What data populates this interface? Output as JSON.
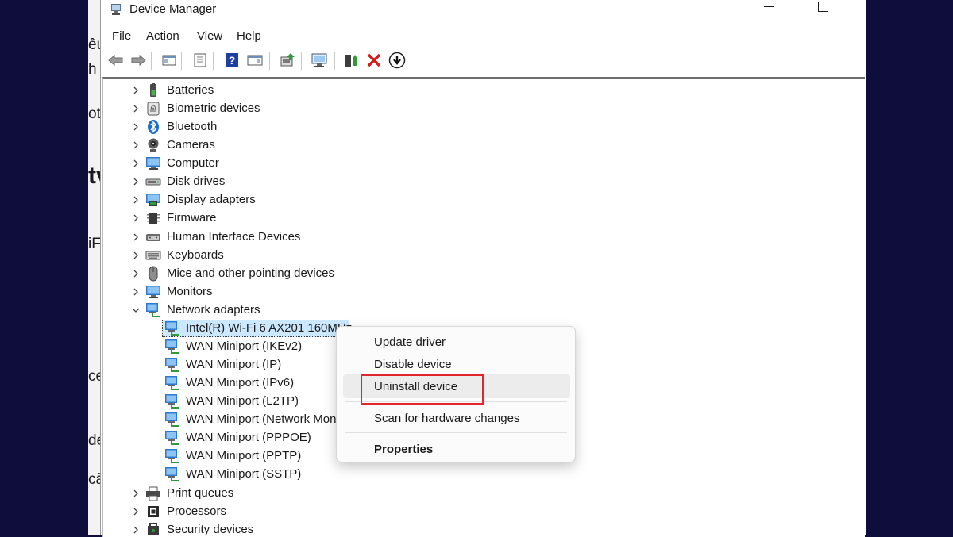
{
  "background_fragments": [
    "êu",
    "h",
    "ot",
    "tv",
    "iF",
    "ce",
    "de",
    "cà"
  ],
  "window": {
    "title": "Device Manager",
    "icons": {
      "app": "device-manager-icon",
      "minimize": "minimize-icon",
      "maximize": "maximize-icon"
    }
  },
  "menu": [
    "File",
    "Action",
    "View",
    "Help"
  ],
  "toolbar": [
    "back-arrow-icon",
    "forward-arrow-icon",
    "show-hide-console-tree-icon",
    "properties-sheet-icon",
    "help-icon",
    "action-pane-icon",
    "update-driver-icon",
    "scan-hardware-icon",
    "enable-device-icon",
    "uninstall-x-icon",
    "download-driver-icon"
  ],
  "tree": {
    "categories": [
      {
        "label": "Batteries",
        "icon": "battery-icon"
      },
      {
        "label": "Biometric devices",
        "icon": "fingerprint-icon"
      },
      {
        "label": "Bluetooth",
        "icon": "bluetooth-icon"
      },
      {
        "label": "Cameras",
        "icon": "camera-icon"
      },
      {
        "label": "Computer",
        "icon": "computer-icon"
      },
      {
        "label": "Disk drives",
        "icon": "disk-drive-icon"
      },
      {
        "label": "Display adapters",
        "icon": "display-adapter-icon"
      },
      {
        "label": "Firmware",
        "icon": "firmware-chip-icon"
      },
      {
        "label": "Human Interface Devices",
        "icon": "hid-icon"
      },
      {
        "label": "Keyboards",
        "icon": "keyboard-icon"
      },
      {
        "label": "Mice and other pointing devices",
        "icon": "mouse-icon"
      },
      {
        "label": "Monitors",
        "icon": "monitor-icon"
      },
      {
        "label": "Network adapters",
        "icon": "network-adapter-icon",
        "expanded": true
      }
    ],
    "network_children": [
      {
        "label": "Intel(R) Wi-Fi 6 AX201 160MHz",
        "selected": true
      },
      {
        "label": "WAN Miniport (IKEv2)"
      },
      {
        "label": "WAN Miniport (IP)"
      },
      {
        "label": "WAN Miniport (IPv6)"
      },
      {
        "label": "WAN Miniport (L2TP)"
      },
      {
        "label": "WAN Miniport (Network Monitor)"
      },
      {
        "label": "WAN Miniport (PPPOE)"
      },
      {
        "label": "WAN Miniport (PPTP)"
      },
      {
        "label": "WAN Miniport (SSTP)"
      }
    ],
    "after_categories": [
      {
        "label": "Print queues",
        "icon": "printer-icon"
      },
      {
        "label": "Processors",
        "icon": "processor-icon"
      },
      {
        "label": "Security devices",
        "icon": "security-device-icon"
      }
    ]
  },
  "context_menu": {
    "items": [
      {
        "label": "Update driver"
      },
      {
        "label": "Disable device"
      },
      {
        "label": "Uninstall device",
        "hovered": true,
        "highlighted": true
      },
      {
        "label": "Scan for hardware changes"
      },
      {
        "label": "Properties",
        "bold": true
      }
    ]
  },
  "colors": {
    "highlight_box": "#e0262a",
    "selection": "#cce8ff",
    "background": "#0f0d3c"
  }
}
